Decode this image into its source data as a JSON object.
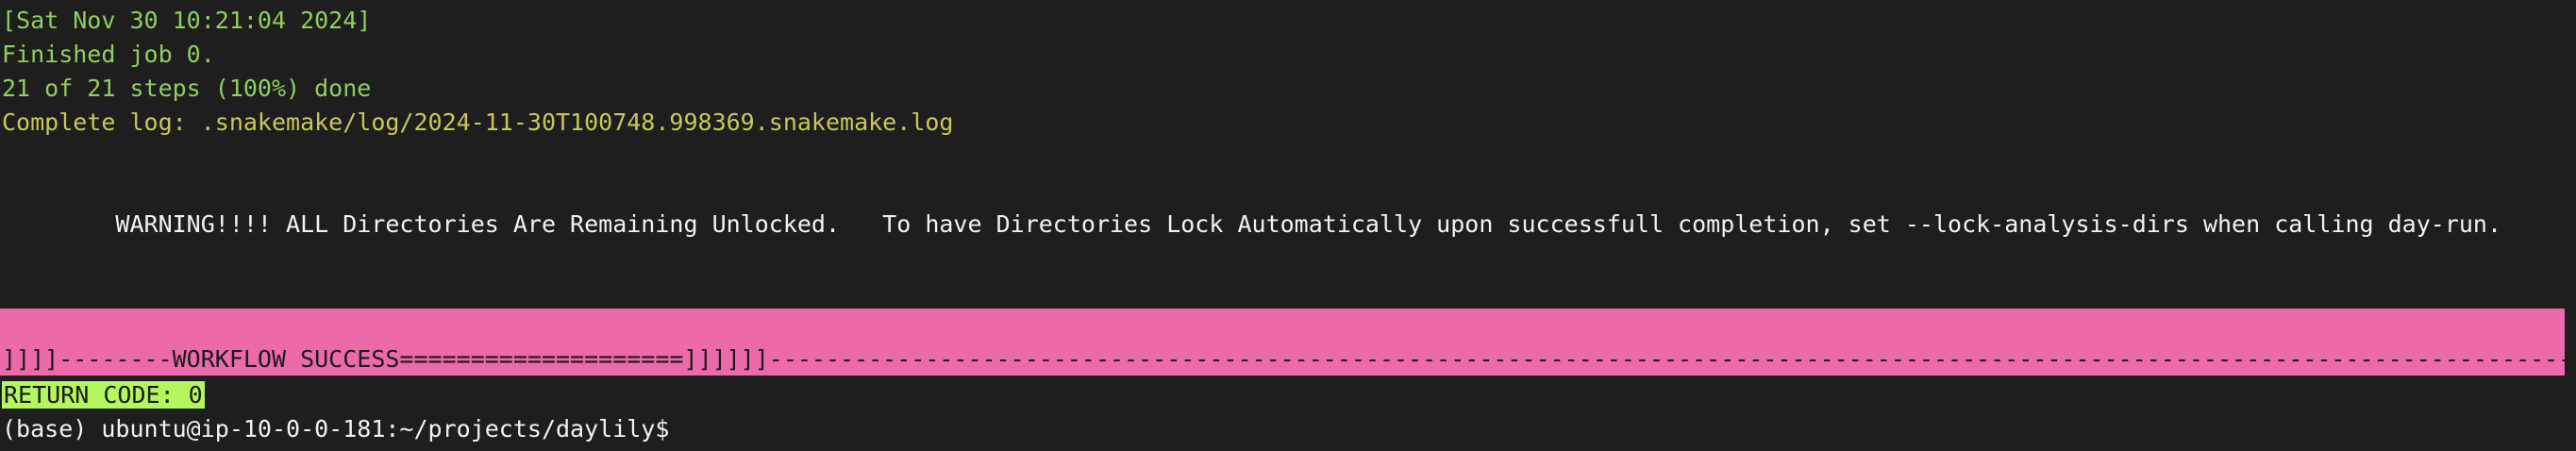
{
  "terminal": {
    "timestamp_line": "[Sat Nov 30 10:21:04 2024]",
    "finished_line": "Finished job 0.",
    "steps_line": "21 of 21 steps (100%) done",
    "log_line": "Complete log: .snakemake/log/2024-11-30T100748.998369.snakemake.log",
    "warning_line": "        WARNING!!!! ALL Directories Are Remaining Unlocked.   To have Directories Lock Automatically upon successfull completion, set --lock-analysis-dirs when calling day-run.",
    "banner_line": "]]]]--------WORKFLOW SUCCESS====================]]]]]]------------------------------------------------------------------------------------------------------------------------------------------------------------",
    "return_code_line": "RETURN CODE: 0",
    "prompt_line": "(base) ubuntu@ip-10-0-0-181:~/projects/daylily$"
  },
  "colors": {
    "background": "#1e1e1e",
    "green_text": "#8fcf5f",
    "yellow_text": "#c8c85a",
    "banner_pink": "#ec6aa9",
    "return_code_bg": "#b5f55e"
  }
}
